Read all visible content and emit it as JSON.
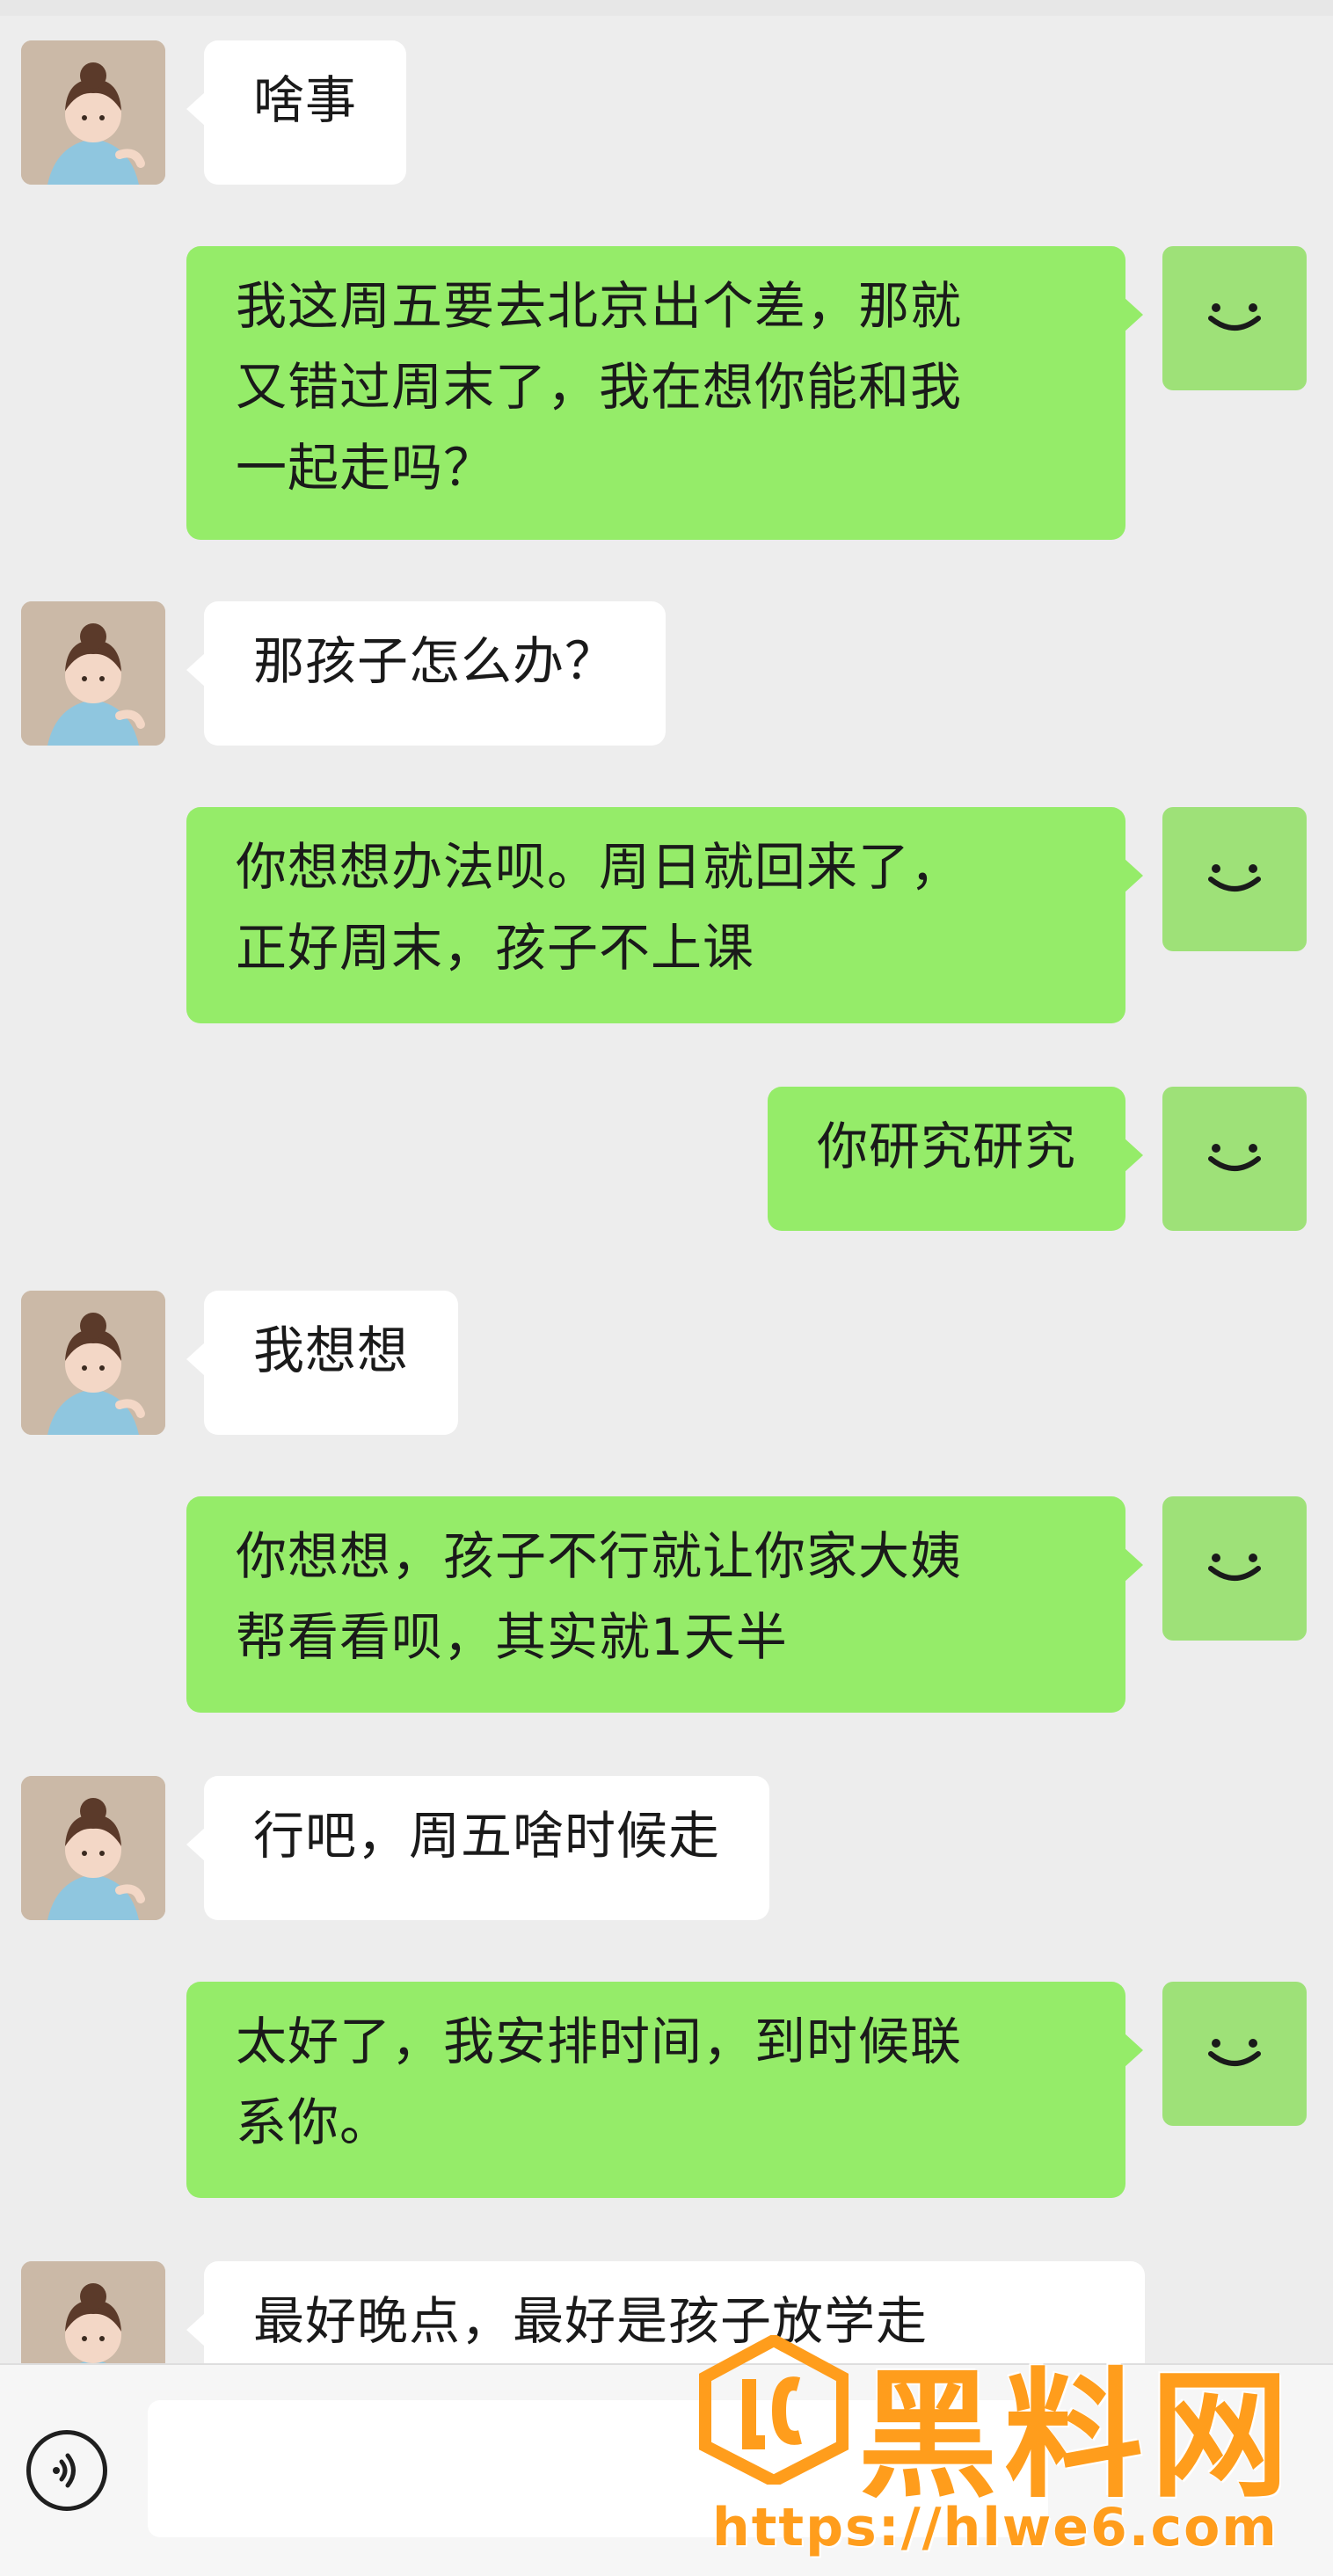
{
  "conversation": {
    "messages": [
      {
        "sender": "contact",
        "text": "啥事"
      },
      {
        "sender": "me",
        "text": "我这周五要去北京出个差，那就\n又错过周末了，我在想你能和我\n一起走吗？"
      },
      {
        "sender": "contact",
        "text": "那孩子怎么办？"
      },
      {
        "sender": "me",
        "text": "你想想办法呗。周日就回来了，\n正好周末，孩子不上课"
      },
      {
        "sender": "me",
        "text": "你研究研究"
      },
      {
        "sender": "contact",
        "text": "我想想"
      },
      {
        "sender": "me",
        "text": "你想想，孩子不行就让你家大姨\n帮看看呗，其实就1天半"
      },
      {
        "sender": "contact",
        "text": "行吧，周五啥时候走"
      },
      {
        "sender": "me",
        "text": "太好了，我安排时间，到时候联\n系你。"
      },
      {
        "sender": "contact",
        "text": "最好晚点，最好是孩子放学走"
      }
    ]
  },
  "input_bar": {
    "voice_icon": "voice-input-icon",
    "message_value": ""
  },
  "watermark": {
    "title": "黑料网",
    "url": "https://hlwe6.com"
  },
  "colors": {
    "background": "#ededed",
    "incoming_bubble": "#ffffff",
    "outgoing_bubble": "#95ec69",
    "watermark": "#ff9d1c"
  }
}
